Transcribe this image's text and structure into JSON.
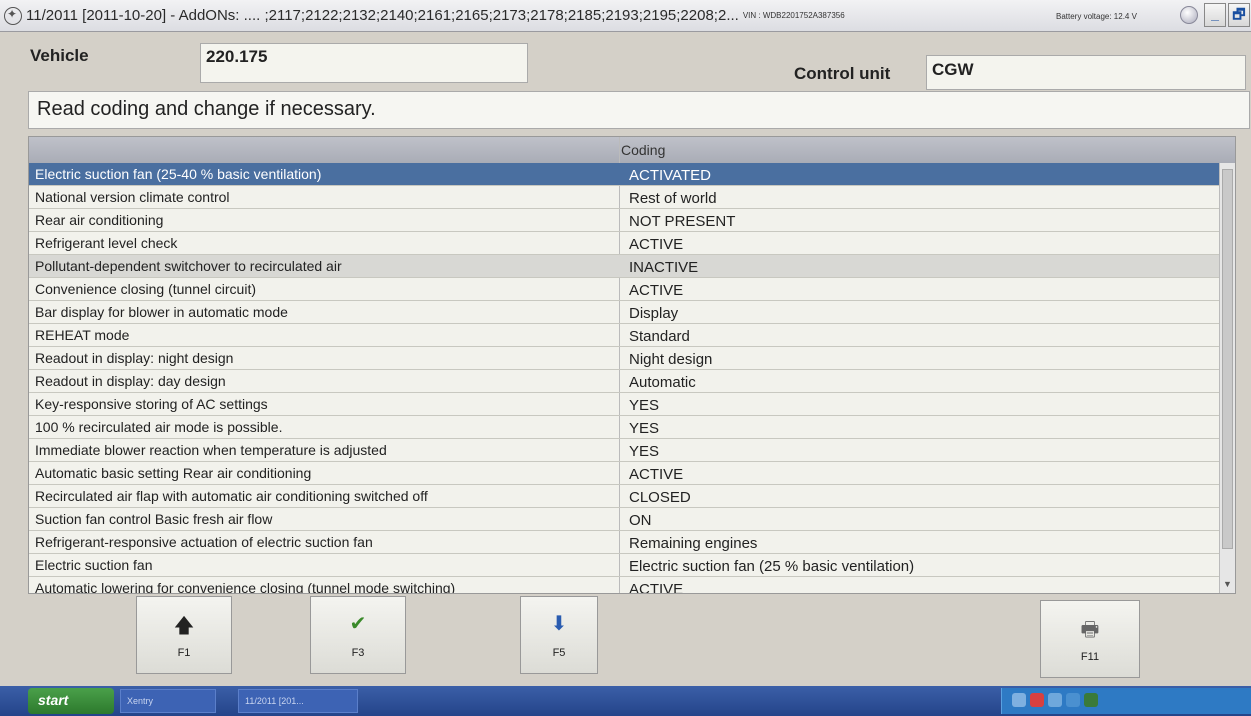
{
  "window": {
    "title": "11/2011 [2011-10-20] - AddONs: .... ;2117;2122;2132;2140;2161;2165;2173;2178;2185;2193;2195;2208;2...",
    "vin": "VIN : WDB2201752A387356",
    "battery": "Battery voltage: 12.4 V",
    "minimize": "_",
    "maximize": "🗗"
  },
  "header": {
    "vehicle_label": "Vehicle",
    "vehicle_value": "220.175",
    "control_unit_label": "Control unit",
    "control_unit_value": "CGW"
  },
  "instruction": "Read coding and change if necessary.",
  "table": {
    "column_coding": "Coding",
    "rows": [
      {
        "name": "Electric suction fan (25-40 % basic ventilation)",
        "value": "ACTIVATED"
      },
      {
        "name": "National version climate control",
        "value": "Rest of world"
      },
      {
        "name": "Rear air conditioning",
        "value": "NOT PRESENT"
      },
      {
        "name": "Refrigerant level check",
        "value": "ACTIVE"
      },
      {
        "name": "Pollutant-dependent switchover to recirculated air",
        "value": "INACTIVE"
      },
      {
        "name": "Convenience closing (tunnel circuit)",
        "value": "ACTIVE"
      },
      {
        "name": "Bar display for blower in automatic mode",
        "value": "Display"
      },
      {
        "name": "REHEAT mode",
        "value": "Standard"
      },
      {
        "name": "Readout in display: night design",
        "value": "Night design"
      },
      {
        "name": "Readout in display: day design",
        "value": "Automatic"
      },
      {
        "name": "Key-responsive storing of AC settings",
        "value": "YES"
      },
      {
        "name": "100 % recirculated air mode is possible.",
        "value": "YES"
      },
      {
        "name": "Immediate blower reaction when temperature is adjusted",
        "value": "YES"
      },
      {
        "name": "Automatic basic setting Rear air conditioning",
        "value": "ACTIVE"
      },
      {
        "name": "Recirculated air flap with automatic air conditioning switched off",
        "value": "CLOSED"
      },
      {
        "name": "Suction fan control Basic fresh air flow",
        "value": "ON"
      },
      {
        "name": "Refrigerant-responsive actuation of electric suction fan",
        "value": "Remaining engines"
      },
      {
        "name": "Electric suction fan",
        "value": "Electric suction fan (25 % basic ventilation)"
      },
      {
        "name": "Automatic lowering for convenience closing (tunnel mode switching)",
        "value": "ACTIVE"
      }
    ]
  },
  "fkeys": {
    "f1": "F1",
    "f3": "F3",
    "f5": "F5",
    "f11": "F11"
  },
  "taskbar": {
    "start": "start",
    "item1": "Xentry",
    "item2": "11/2011 [201..."
  }
}
